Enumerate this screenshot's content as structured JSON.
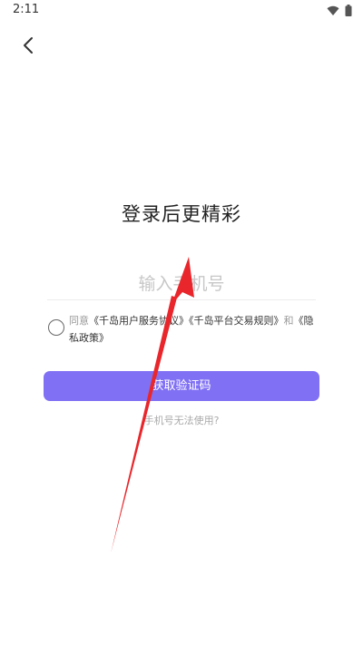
{
  "status_bar": {
    "time": "2:11",
    "icons": [
      "wifi-icon",
      "battery-icon"
    ]
  },
  "nav": {
    "back_icon": "chevron-left-icon"
  },
  "login": {
    "title": "登录后更精彩",
    "phone_placeholder": "输入手机号",
    "agreement": {
      "prefix": "同意",
      "terms_1": "《千岛用户服务协议》",
      "terms_2": "《千岛平台交易规则》",
      "conjunction": "和",
      "terms_3": "《隐私政策》"
    },
    "submit_label": "获取验证码",
    "help_link": "手机号无法使用?"
  },
  "colors": {
    "accent": "#8070f4",
    "annotation_arrow": "#e8262b"
  }
}
